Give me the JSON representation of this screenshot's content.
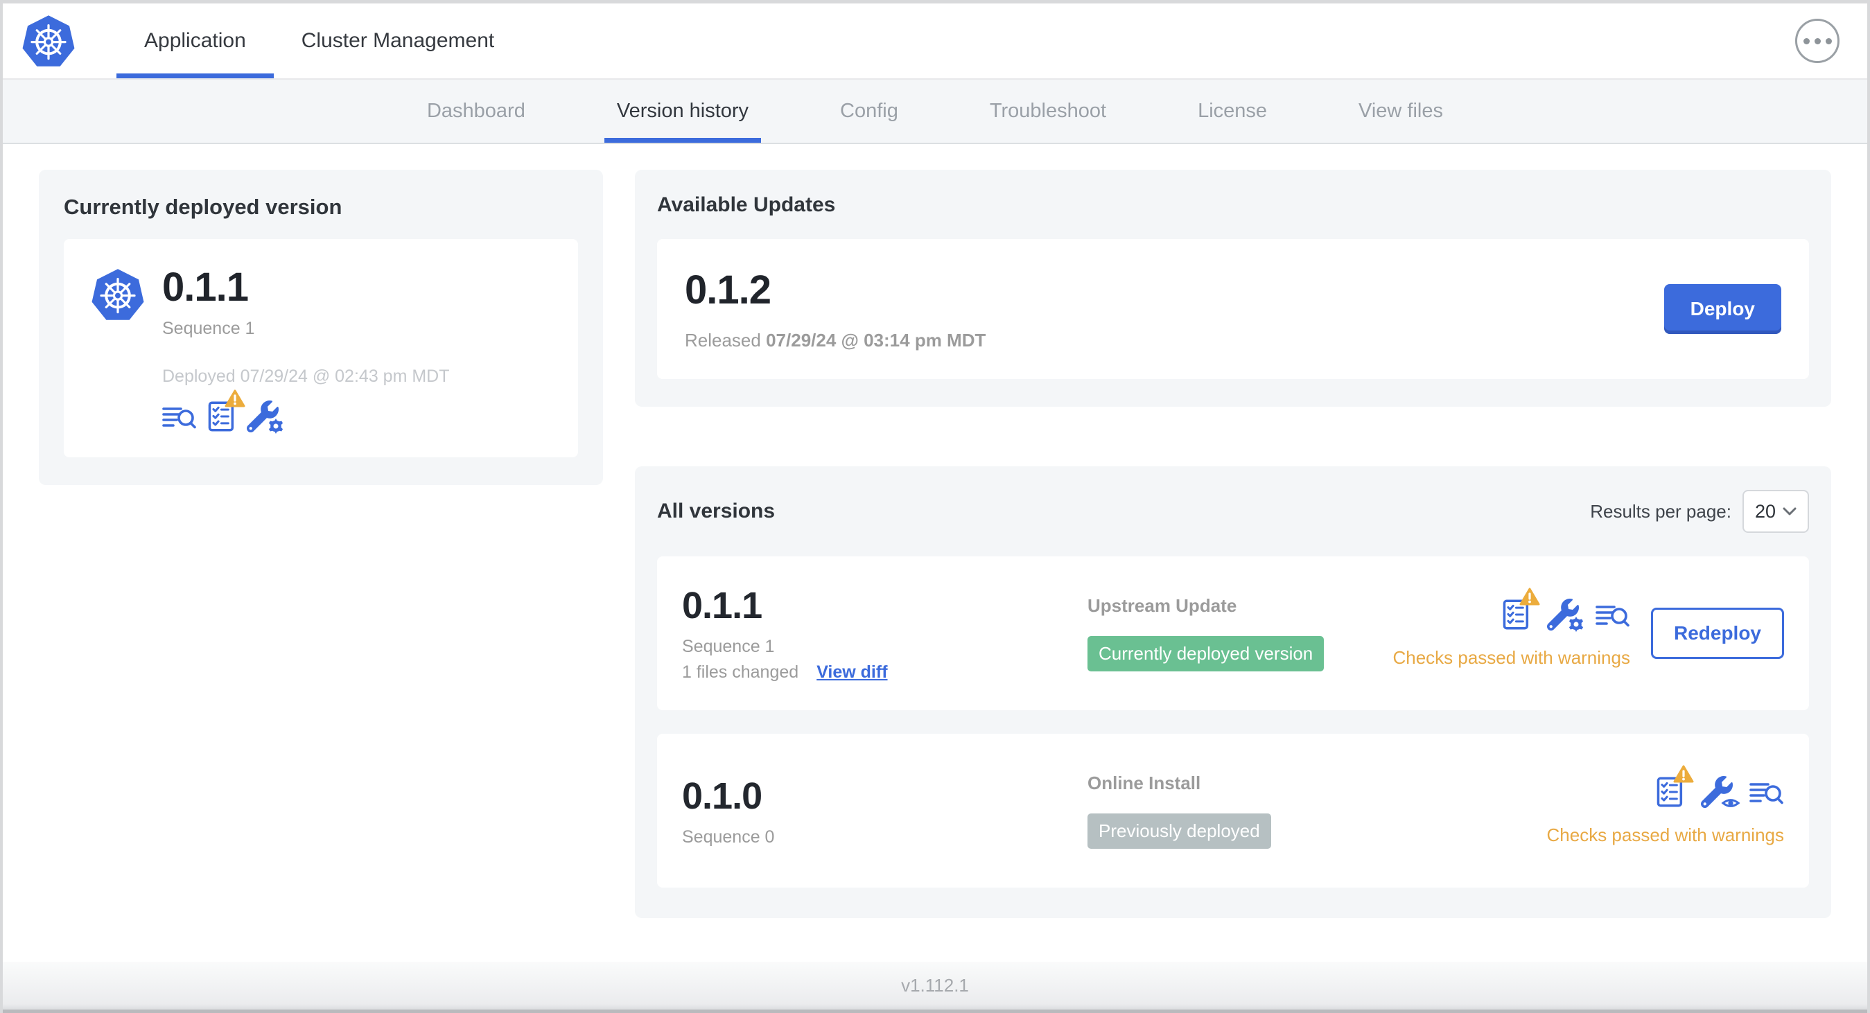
{
  "topnav": {
    "tabs": [
      {
        "label": "Application",
        "active": true
      },
      {
        "label": "Cluster Management",
        "active": false
      }
    ]
  },
  "subnav": {
    "tabs": [
      {
        "label": "Dashboard",
        "active": false
      },
      {
        "label": "Version history",
        "active": true
      },
      {
        "label": "Config",
        "active": false
      },
      {
        "label": "Troubleshoot",
        "active": false
      },
      {
        "label": "License",
        "active": false
      },
      {
        "label": "View files",
        "active": false
      }
    ]
  },
  "deployed_card": {
    "title": "Currently deployed version",
    "version": "0.1.1",
    "sequence": "Sequence 1",
    "deployed_at": "Deployed 07/29/24 @ 02:43 pm MDT"
  },
  "available_updates": {
    "title": "Available Updates",
    "version": "0.1.2",
    "released_prefix": "Released",
    "released_at": "07/29/24 @ 03:14 pm MDT",
    "deploy_label": "Deploy"
  },
  "all_versions": {
    "title": "All versions",
    "results_per_page_label": "Results per page:",
    "results_per_page_value": "20",
    "rows": [
      {
        "version": "0.1.1",
        "sequence": "Sequence 1",
        "files_changed": "1 files changed",
        "view_diff_label": "View diff",
        "source": "Upstream Update",
        "badge": "Currently deployed version",
        "badge_color": "#6ac092",
        "action_label": "Redeploy",
        "checks_status": "Checks passed with warnings"
      },
      {
        "version": "0.1.0",
        "sequence": "Sequence 0",
        "source": "Online Install",
        "badge": "Previously deployed",
        "badge_color": "#b6c0c2",
        "checks_status": "Checks passed with warnings"
      }
    ]
  },
  "footer": {
    "app_version": "v1.112.1"
  },
  "icons": {
    "logo": "kubernetes-logo",
    "left_card": [
      "view-logs-icon",
      "preflight-checks-warning-icon",
      "edit-config-icon"
    ],
    "row_0": [
      "preflight-checks-warning-icon",
      "edit-config-icon",
      "view-logs-icon"
    ],
    "row_1": [
      "preflight-checks-warning-icon",
      "view-config-icon",
      "view-logs-icon"
    ]
  },
  "colors": {
    "primary_blue": "#3c6bdc",
    "badge_green": "#6ac092",
    "badge_gray": "#b6c0c2",
    "warning_orange": "#e8a944",
    "card_bg": "#f4f6f8",
    "muted_text": "#9b9b9b"
  }
}
